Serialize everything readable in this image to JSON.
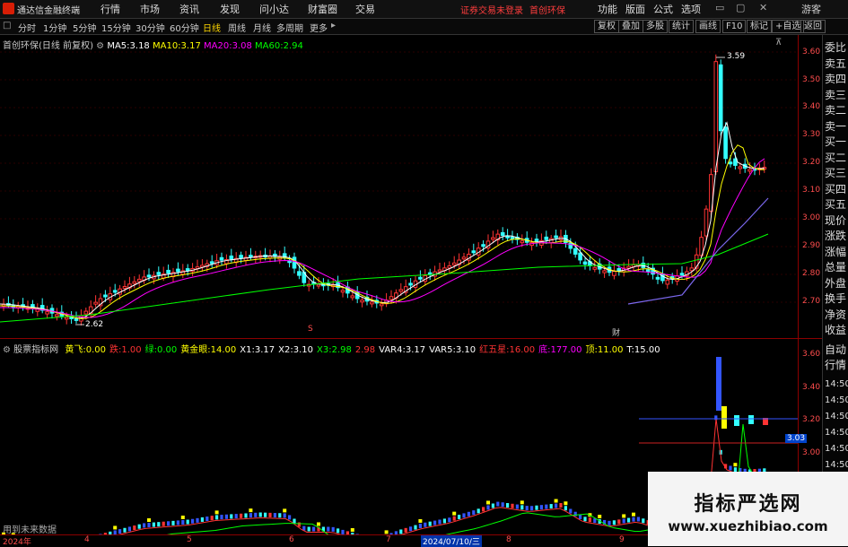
{
  "app": {
    "title": "通达信金融终端"
  },
  "menu": {
    "items": [
      "行情",
      "市场",
      "资讯",
      "发现",
      "问小达",
      "财富圈",
      "交易"
    ],
    "notice_red": "证券交易未登录",
    "stock_red": "首创环保",
    "right": [
      "功能",
      "版面",
      "公式",
      "选项"
    ],
    "guest": "游客"
  },
  "toolbar": {
    "periods": [
      "分时",
      "1分钟",
      "5分钟",
      "15分钟",
      "30分钟",
      "60分钟",
      "日线",
      "周线",
      "月线",
      "多周期",
      "更多"
    ],
    "active": "日线",
    "right": [
      "复权",
      "叠加",
      "多股",
      "统计",
      "画线",
      "F10",
      "标记",
      "+自选",
      "返回"
    ]
  },
  "main_chart": {
    "legend_name": "首创环保(日线 前复权)",
    "ma": [
      {
        "label": "MA5:",
        "value": "3.18",
        "color": "#ffffff"
      },
      {
        "label": "MA10:",
        "value": "3.17",
        "color": "#ffff00"
      },
      {
        "label": "MA20:",
        "value": "3.08",
        "color": "#ff00ff"
      },
      {
        "label": "MA60:",
        "value": "2.94",
        "color": "#00ff00"
      }
    ],
    "price_ticks": [
      "3.60",
      "3.50",
      "3.40",
      "3.30",
      "3.20",
      "3.10",
      "3.00",
      "2.90",
      "2.80",
      "2.70"
    ],
    "high_label": "3.59",
    "low_label": "2.62",
    "marker_s": "S",
    "marker_cai": "财",
    "line_colors": {
      "ma5": "#ffffff",
      "ma10": "#ffff00",
      "ma20": "#ff00ff",
      "ma60": "#00ff00",
      "ma_long": "#7b68ee"
    }
  },
  "right_panel": {
    "items": [
      "委比",
      "卖五",
      "卖四",
      "卖三",
      "卖二",
      "卖一",
      "买一",
      "买二",
      "买三",
      "买四",
      "买五",
      "现价",
      "涨跌",
      "涨幅",
      "总量",
      "外盘",
      "换手",
      "净资",
      "收益"
    ],
    "lower": [
      "自动",
      "行情"
    ],
    "times": [
      "14:50",
      "14:50",
      "14:50",
      "14:50",
      "14:50",
      "14:50",
      "14:50"
    ]
  },
  "sub_chart": {
    "name": "股票指标网",
    "indicators": [
      {
        "label": "黄飞:",
        "value": "0.00",
        "color": "#ffff00"
      },
      {
        "label": "跌:",
        "value": "1.00",
        "color": "#ff3333"
      },
      {
        "label": "绿:",
        "value": "0.00",
        "color": "#00ff00"
      },
      {
        "label": "黄金眼:",
        "value": "14.00",
        "color": "#ffff00"
      },
      {
        "label": "X1:",
        "value": "3.17",
        "color": "#ffffff"
      },
      {
        "label": "X2:",
        "value": "3.10",
        "color": "#ffffff"
      },
      {
        "label": "X3:",
        "value": "2.98",
        "color": "#00ff00"
      },
      {
        "label": "",
        "value": "2.98",
        "color": "#ff3333"
      },
      {
        "label": "VAR4:",
        "value": "3.17",
        "color": "#ffffff"
      },
      {
        "label": "VAR5:",
        "value": "3.10",
        "color": "#ffffff"
      },
      {
        "label": "红五星:",
        "value": "16.00",
        "color": "#ff3333"
      },
      {
        "label": "底:",
        "value": "177.00",
        "color": "#ff00ff"
      },
      {
        "label": "顶:",
        "value": "11.00",
        "color": "#ffff00"
      },
      {
        "label": "T:",
        "value": "15.00",
        "color": "#ffffff"
      }
    ],
    "axis_ticks": [
      "3.60",
      "3.40",
      "3.20",
      "3.00"
    ],
    "current_price": "3.03",
    "footer_text": "用到未来数据"
  },
  "date_axis": {
    "labels": [
      "2024年",
      "4",
      "5",
      "6",
      "7",
      "2024/07/10/三",
      "8",
      "9"
    ]
  },
  "watermark": {
    "title": "指标严选网",
    "url": "www.xuezhibiao.com"
  }
}
